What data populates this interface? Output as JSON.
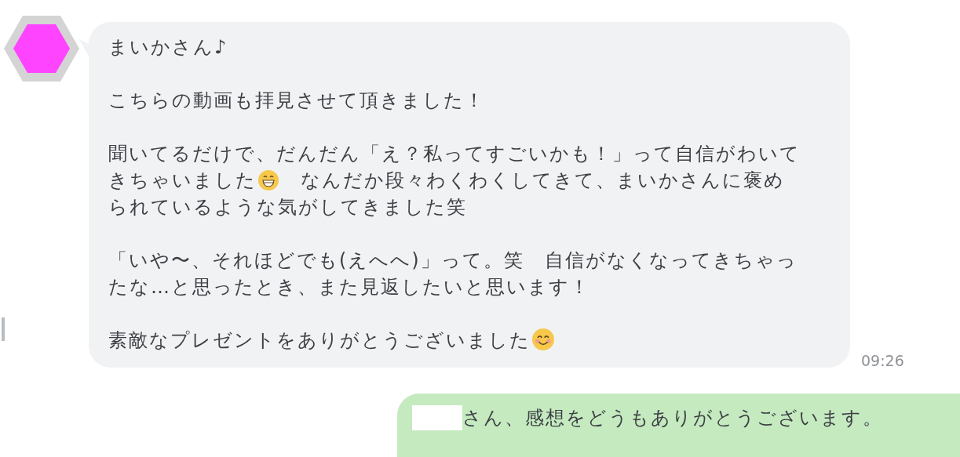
{
  "incoming": {
    "paragraphs": [
      [
        [
          {
            "kind": "text",
            "text": "まいかさん♪"
          }
        ]
      ],
      [
        [
          {
            "kind": "text",
            "text": "こちらの動画も拝見させて頂きました！"
          }
        ]
      ],
      [
        [
          {
            "kind": "text",
            "text": "聞いてるだけで、だんだん「え？私ってすごいかも！」って自信がわいて"
          }
        ],
        [
          {
            "kind": "text",
            "text": "きちゃいました"
          },
          {
            "kind": "grin"
          },
          {
            "kind": "text",
            "text": "　なんだか段々わくわくしてきて、まいかさんに褒め"
          }
        ],
        [
          {
            "kind": "text",
            "text": "られているような気がしてきました笑"
          }
        ]
      ],
      [
        [
          {
            "kind": "text",
            "text": "「いや〜、それほどでも(えへへ)」って。笑　自信がなくなってきちゃっ"
          }
        ],
        [
          {
            "kind": "text",
            "text": "たな…と思ったとき、また見返したいと思います！"
          }
        ]
      ],
      [
        [
          {
            "kind": "text",
            "text": "素敵なプレゼントをありがとうございました"
          },
          {
            "kind": "smile"
          }
        ]
      ]
    ],
    "time": "09:26"
  },
  "outgoing": {
    "text": "さん、感想をどうもありがとうございます。"
  }
}
